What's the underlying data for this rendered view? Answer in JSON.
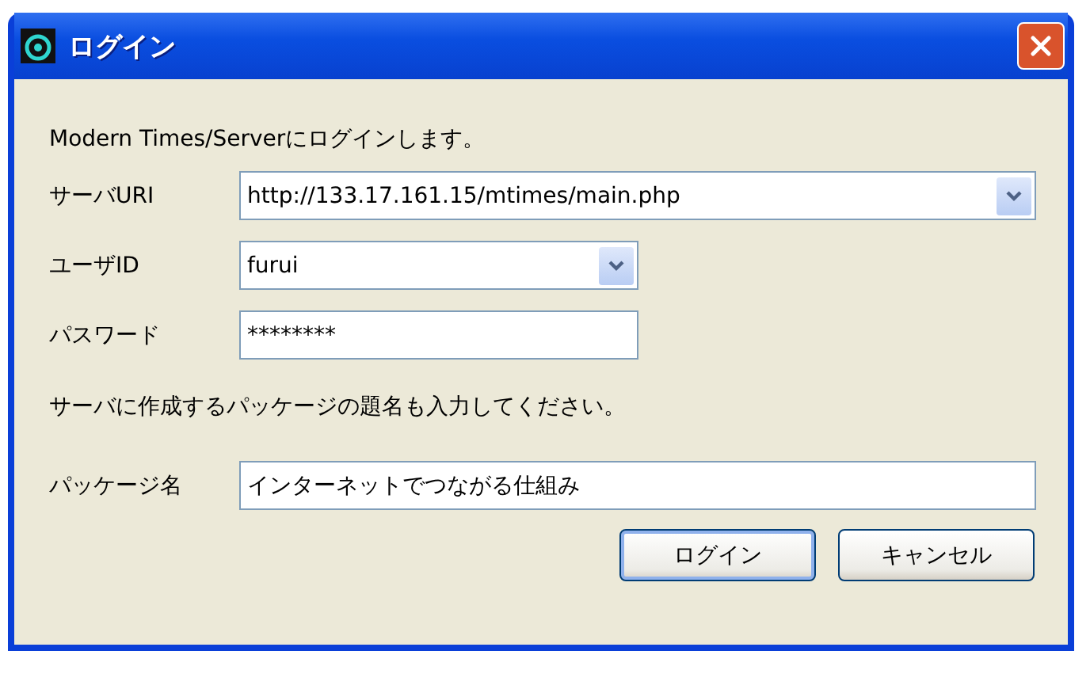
{
  "window": {
    "title": "ログイン"
  },
  "intro": "Modern Times/Serverにログインします。",
  "fields": [
    {
      "label": "サーバURI",
      "value": "http://133.17.161.15/mtimes/main.php",
      "kind": "combo"
    },
    {
      "label": "ユーザID",
      "value": "furui",
      "kind": "combo"
    },
    {
      "label": "パスワード",
      "value": "********",
      "kind": "text"
    }
  ],
  "note": "サーバに作成するパッケージの題名も入力してください。",
  "package": {
    "label": "パッケージ名",
    "value": "インターネットでつながる仕組み"
  },
  "buttons": [
    {
      "label": "ログイン",
      "default": true
    },
    {
      "label": "キャンセル",
      "default": false
    }
  ]
}
